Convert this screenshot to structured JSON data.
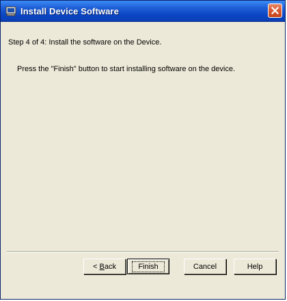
{
  "window": {
    "title": "Install Device Software",
    "icon": "installer-window-icon",
    "close_icon": "close-icon"
  },
  "wizard": {
    "step_text": "Step 4 of 4:  Install the software on the Device.",
    "instruction_text": "Press the \"Finish\" button to start installing software on the device."
  },
  "buttons": {
    "back_prefix": "< ",
    "back_mnemonic": "B",
    "back_rest": "ack",
    "finish": "Finish",
    "cancel": "Cancel",
    "help": "Help"
  },
  "colors": {
    "titlebar": "#0a46c4",
    "dialog_background": "#ece9d8",
    "close_button": "#d95b33"
  }
}
